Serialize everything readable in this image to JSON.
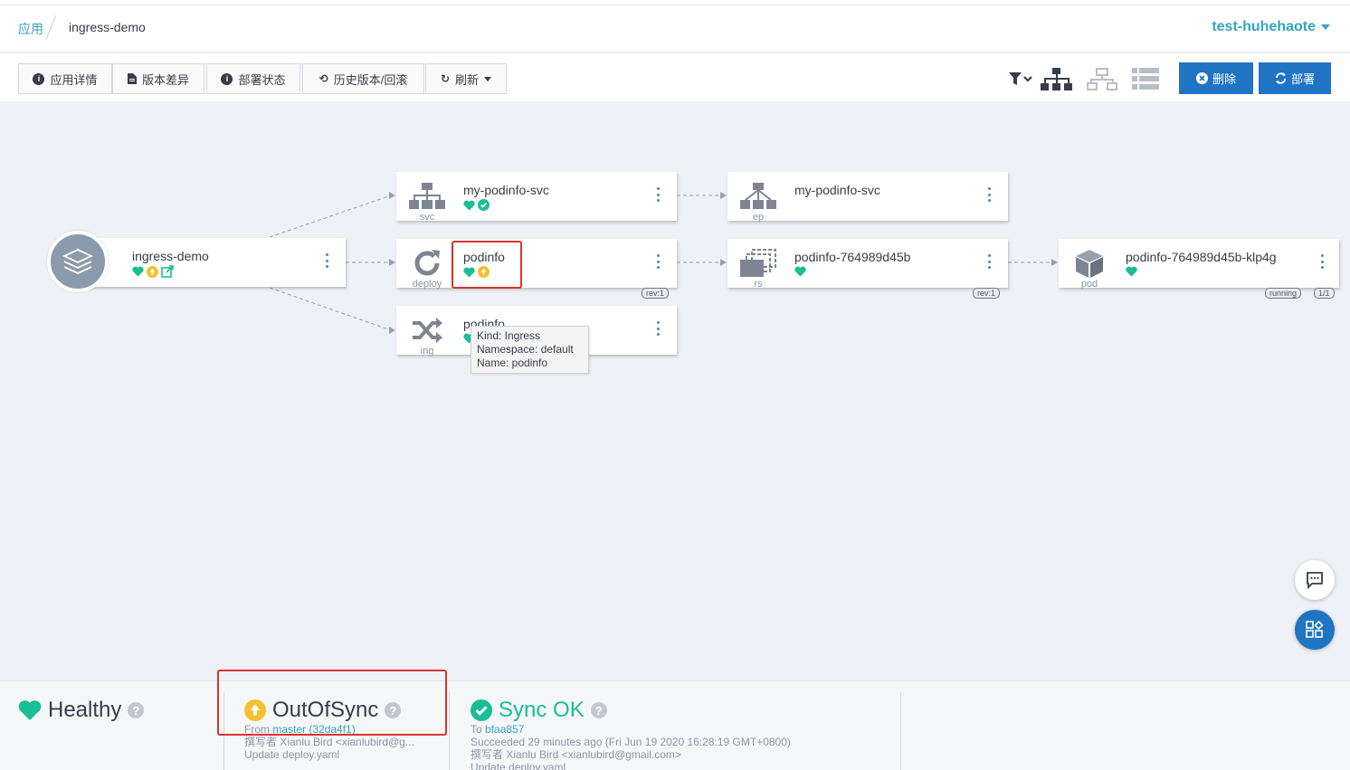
{
  "breadcrumb": {
    "root": "应用",
    "current": "ingress-demo"
  },
  "account": {
    "name": "test-huhehaote"
  },
  "toolbar": {
    "app_details": "应用详情",
    "app_diff": "版本差异",
    "sync_status": "部署状态",
    "history": "历史版本/回滚",
    "refresh": "刷新"
  },
  "actions": {
    "delete": "删除",
    "sync": "部署"
  },
  "colors": {
    "accent": "#36a2c4",
    "primary_button": "#1f74c4",
    "healthy": "#18be94",
    "out_of_sync": "#f4c030",
    "highlight": "#d8342f"
  },
  "graph": {
    "app_node": {
      "name": "ingress-demo",
      "icon": "layers-icon"
    },
    "nodes": {
      "svc": {
        "name": "my-podinfo-svc",
        "kind": "svc"
      },
      "deploy": {
        "name": "podinfo",
        "kind": "deploy",
        "rev": "rev:1"
      },
      "ing": {
        "name": "podinfo",
        "kind": "ing"
      },
      "ep": {
        "name": "my-podinfo-svc",
        "kind": "ep"
      },
      "rs": {
        "name": "podinfo-764989d45b",
        "kind": "rs",
        "rev": "rev:1"
      },
      "pod": {
        "name": "podinfo-764989d45b-klp4g",
        "kind": "pod",
        "state": "running",
        "ready": "1/1"
      }
    },
    "tooltip": {
      "line1": "Kind: Ingress",
      "line2": "Namespace: default",
      "line3": "Name: podinfo"
    }
  },
  "status_panel": {
    "health": {
      "title": "Healthy"
    },
    "sync": {
      "title": "OutOfSync",
      "from_label": "From",
      "from_ref": "master (32da4f1)",
      "author": "撰写者 Xianlu Bird <xianlubird@g...",
      "message": "Update deploy.yaml"
    },
    "operation": {
      "title": "Sync OK",
      "to_label": "To",
      "to_ref": "bfaa857",
      "succeeded": "Succeeded 29 minutes ago (Fri Jun 19 2020 16:28:19 GMT+0800)",
      "author": "撰写者 Xianlu Bird <xianlubird@gmail.com>",
      "message": "Update deploy.yaml"
    }
  }
}
